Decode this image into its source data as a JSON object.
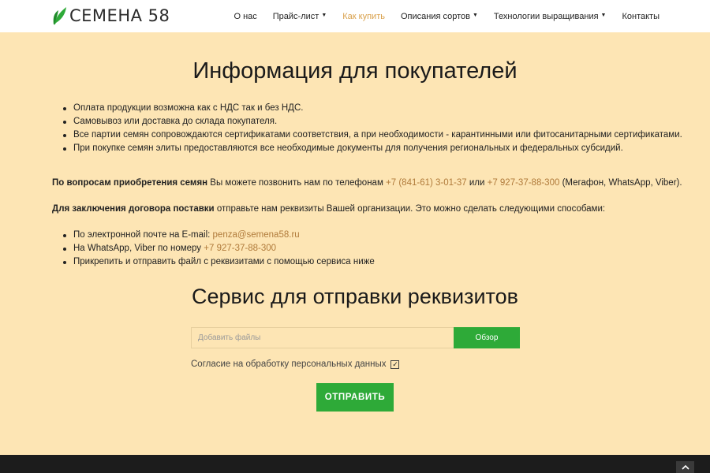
{
  "header": {
    "logo_text": "СЕМЕНА 58",
    "nav": [
      {
        "label": "О нас",
        "has_dropdown": false,
        "active": false
      },
      {
        "label": "Прайс-лист",
        "has_dropdown": true,
        "active": false
      },
      {
        "label": "Как купить",
        "has_dropdown": false,
        "active": true
      },
      {
        "label": "Описания сортов",
        "has_dropdown": true,
        "active": false
      },
      {
        "label": "Технологии выращивания",
        "has_dropdown": true,
        "active": false
      },
      {
        "label": "Контакты",
        "has_dropdown": false,
        "active": false
      }
    ]
  },
  "main": {
    "title": "Информация для покупателей",
    "info_items": [
      "Оплата продукции возможна как с НДС так и без НДС.",
      "Самовывоз или доставка до склада покупателя.",
      "Все партии семян сопровождаются сертификатами соответствия, а при необходимости - карантинными или фитосанитарными сертификатами.",
      "При покупке семян элиты предоставляются все необходимые документы для получения региональных и федеральных субсидий."
    ],
    "purchase_para": {
      "bold": "По вопросам приобретения семян",
      "text1": " Вы можете позвонить нам по телефонам ",
      "phone1": "+7 (841-61) 3-01-37",
      "text2": " или ",
      "phone2": "+7 927-37-88-300",
      "text3": " (Мегафон, WhatsApp, Viber)."
    },
    "contract_para": {
      "bold": "Для заключения договора поставки",
      "text": " отправьте нам реквизиты Вашей организации. Это можно сделать следующими способами:"
    },
    "ways": {
      "email_label": "По электронной почте на E-mail: ",
      "email": "penza@semena58.ru",
      "whatsapp_label": "На WhatsApp, Viber по номеру ",
      "whatsapp_phone": "+7 927-37-88-300",
      "attach": "Прикрепить и отправить файл с реквизитами с помощью сервиса ниже"
    }
  },
  "service": {
    "title": "Сервис для отправки реквизитов",
    "file_placeholder": "Добавить файлы",
    "browse_label": "Обзор",
    "consent_label": "Согласие на обработку персональных данных",
    "consent_checked": true,
    "submit_label": "ОТПРАВИТЬ"
  },
  "colors": {
    "background": "#fde5b4",
    "accent_green": "#2eaa38",
    "link": "#b07a3a",
    "nav_active": "#d9a14c",
    "footer": "#1c1c1c"
  },
  "icons": {
    "logo": "leaf-icon",
    "dropdown": "chevron-down-icon",
    "scroll_top": "chevron-up-icon",
    "checkbox": "check-icon"
  }
}
